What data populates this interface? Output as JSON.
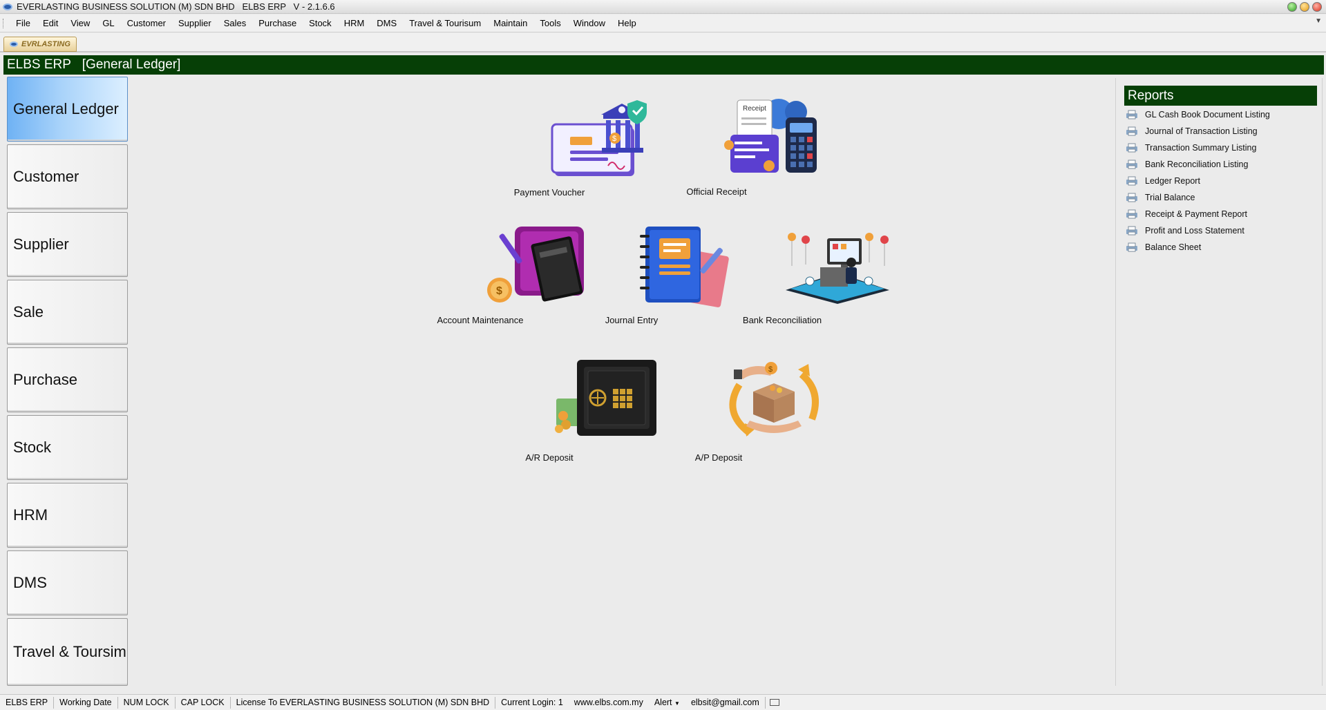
{
  "window": {
    "title": "EVERLASTING BUSINESS SOLUTION (M) SDN BHD   ELBS ERP   V - 2.1.6.6"
  },
  "menu": [
    "File",
    "Edit",
    "View",
    "GL",
    "Customer",
    "Supplier",
    "Sales",
    "Purchase",
    "Stock",
    "HRM",
    "DMS",
    "Travel & Tourisum",
    "Maintain",
    "Tools",
    "Window",
    "Help"
  ],
  "tab": {
    "label": "EVRLASTING"
  },
  "header": {
    "app": "ELBS ERP",
    "module": "[General Ledger]"
  },
  "sidebar": {
    "active_index": 0,
    "items": [
      "General Ledger",
      "Customer",
      "Supplier",
      "Sale",
      "Purchase",
      "Stock",
      "HRM",
      "DMS",
      "Travel & Toursim"
    ]
  },
  "tiles": {
    "payment_voucher": "Payment Voucher",
    "official_receipt": "Official Receipt",
    "receipt_word": "Receipt",
    "account_maintenance": "Account Maintenance",
    "journal_entry": "Journal Entry",
    "bank_reconciliation": "Bank Reconciliation",
    "ar_deposit": "A/R Deposit",
    "ap_deposit": "A/P Deposit"
  },
  "reports": {
    "title": "Reports",
    "items": [
      "GL Cash Book Document Listing",
      "Journal of Transaction Listing",
      "Transaction Summary Listing",
      "Bank Reconciliation Listing",
      "Ledger Report",
      "Trial Balance",
      "Receipt & Payment Report",
      "Profit and Loss Statement",
      "Balance Sheet"
    ]
  },
  "status": {
    "app": "ELBS ERP",
    "working_date": "Working Date",
    "num_lock": "NUM LOCK",
    "cap_lock": "CAP LOCK",
    "license": "License To EVERLASTING BUSINESS SOLUTION (M) SDN BHD",
    "login": "Current Login: 1",
    "website": "www.elbs.com.my",
    "alert": "Alert",
    "email": "elbsit@gmail.com"
  },
  "colors": {
    "header_green": "#063f06",
    "active_blue": "#6fb2f4"
  }
}
